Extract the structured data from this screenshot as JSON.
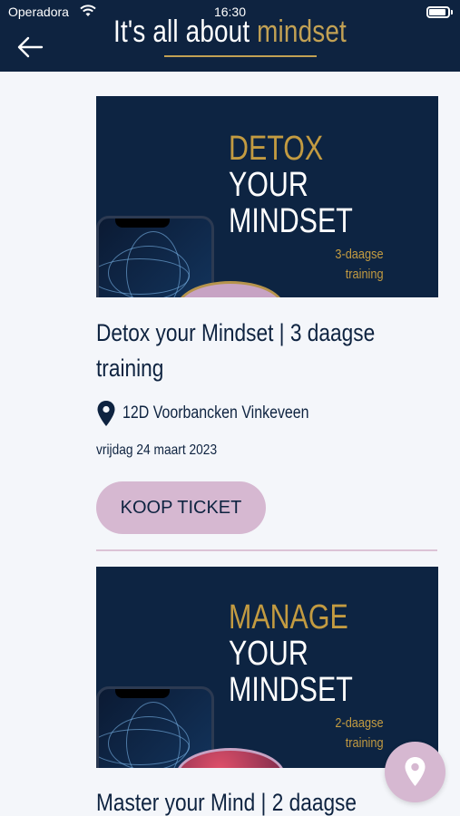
{
  "status_bar": {
    "carrier": "Operadora",
    "time": "16:30"
  },
  "header": {
    "title_prefix": "It's all about ",
    "title_accent": "mindset",
    "back_icon": "arrow-left-icon"
  },
  "cards": [
    {
      "image": {
        "line1": "DETOX",
        "line2": "YOUR",
        "line3": "MINDSET",
        "sub1": "3-daagse",
        "sub2": "training"
      },
      "title_line1": "Detox your Mindset | 3 daagse",
      "title_line2": "training",
      "location": "12D Voorbancken Vinkeveen",
      "date": "vrijdag 24 maart 2023",
      "button_label": "KOOP TICKET"
    },
    {
      "image": {
        "line1": "MANAGE",
        "line2": "YOUR",
        "line3": "MINDSET",
        "sub1": "2-daagse",
        "sub2": "training"
      },
      "title_line1": "Master your Mind | 2 daagse"
    }
  ],
  "fab": {
    "icon": "map-pin-icon"
  },
  "colors": {
    "navy": "#0e2340",
    "gold": "#c2a154",
    "pink": "#d6b8d1",
    "background": "#f4f6fa"
  }
}
